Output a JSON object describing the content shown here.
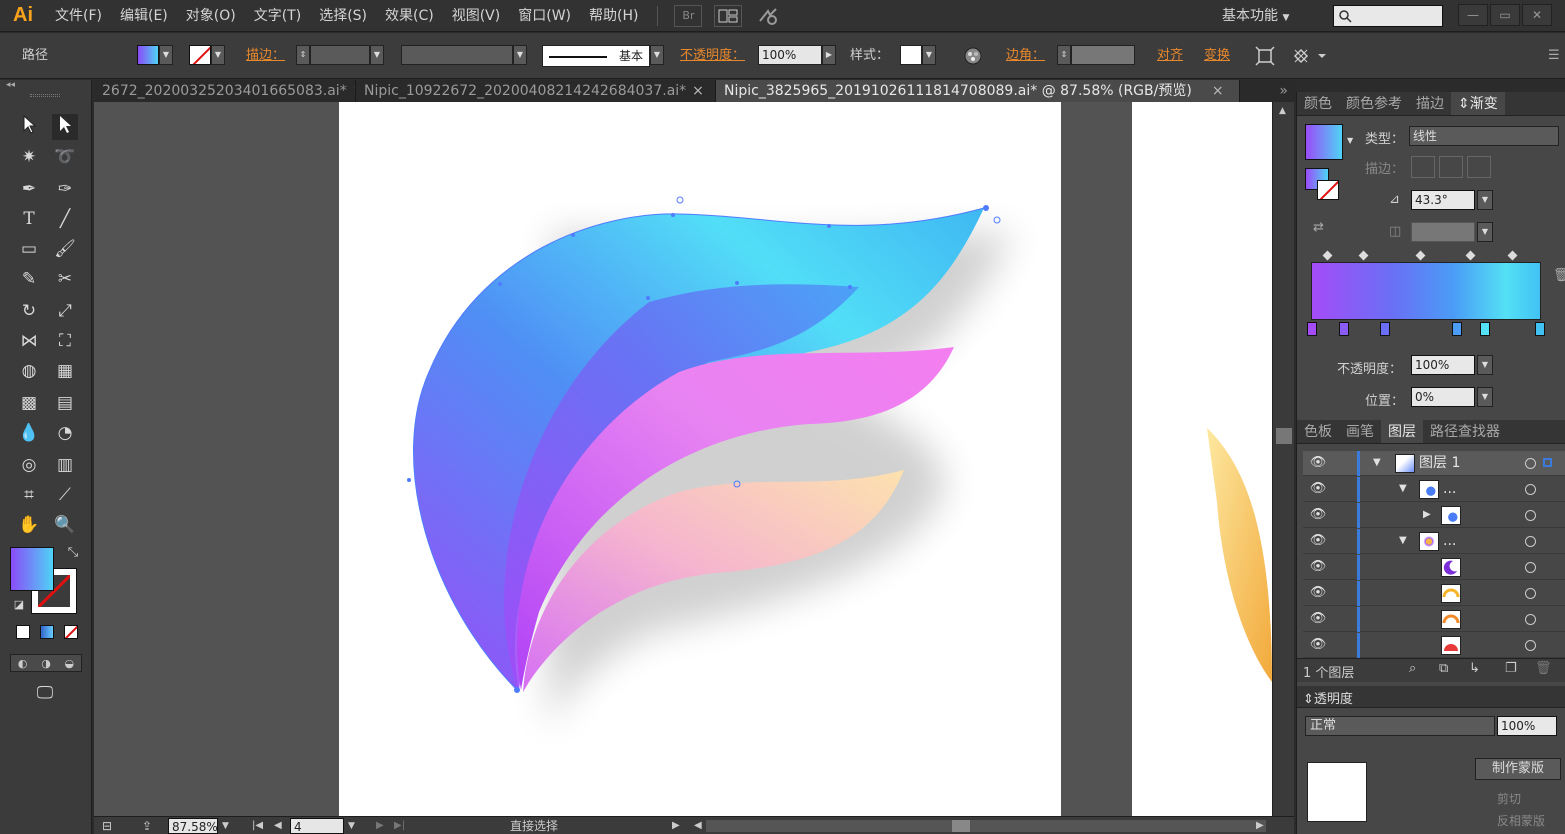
{
  "menubar": {
    "logo": "Ai",
    "items": [
      "文件(F)",
      "编辑(E)",
      "对象(O)",
      "文字(T)",
      "选择(S)",
      "效果(C)",
      "视图(V)",
      "窗口(W)",
      "帮助(H)"
    ],
    "bridge_label": "Br",
    "workspace": "基本功能",
    "search_placeholder": "",
    "win_min": "—",
    "win_restore": "▭",
    "win_close": "✕"
  },
  "controlbar": {
    "selection_type": "路径",
    "stroke_label": "描边：",
    "stroke_style": "基本",
    "opacity_label": "不透明度：",
    "opacity_value": "100%",
    "style_label": "样式：",
    "corner_label": "边角：",
    "align_label": "对齐",
    "transform_label": "变换"
  },
  "tabs": [
    {
      "label": "2672_20200325203401665083.ai*",
      "active": false
    },
    {
      "label": "Nipic_10922672_20200408214242684037.ai*",
      "active": false
    },
    {
      "label": "Nipic_3825965_20191026111814708089.ai* @ 87.58% (RGB/预览)",
      "active": true
    }
  ],
  "tab_close": "×",
  "tab_overflow": "»",
  "statusbar": {
    "zoom": "87.58%",
    "artboard": "4",
    "tool_name": "直接选择"
  },
  "gradient_panel": {
    "tabs": [
      "颜色",
      "颜色参考",
      "描边",
      "渐变"
    ],
    "active_tab": "渐变",
    "type_label": "类型：",
    "type_value": "线性",
    "stroke_label": "描边：",
    "angle_value": "43.3°",
    "opacity_label": "不透明度：",
    "opacity_value": "100%",
    "position_label": "位置：",
    "position_value": "0%",
    "colors": [
      "#a44cf8",
      "#6a6ff5",
      "#4a9cf6",
      "#54e0f5",
      "#41c2f3"
    ]
  },
  "layers_panel": {
    "tabs": [
      "色板",
      "画笔",
      "图层",
      "路径查找器"
    ],
    "active_tab": "图层",
    "rows": [
      {
        "name": "图层 1",
        "indent": 0,
        "expanded": true
      },
      {
        "name": "...",
        "indent": 1,
        "expanded": true
      },
      {
        "name": "",
        "indent": 2,
        "expanded": false
      },
      {
        "name": "...",
        "indent": 1,
        "expanded": true
      },
      {
        "name": "",
        "indent": 2,
        "expanded": null
      },
      {
        "name": "",
        "indent": 2,
        "expanded": null
      },
      {
        "name": "",
        "indent": 2,
        "expanded": null
      },
      {
        "name": "",
        "indent": 2,
        "expanded": null
      }
    ],
    "footer_count": "1 个图层"
  },
  "transparency_panel": {
    "title": "透明度",
    "blend_mode": "正常",
    "opacity_value": "100%",
    "make_mask": "制作蒙版",
    "clip_label": "剪切",
    "invert_label": "反相蒙版"
  },
  "accent_color": "#e8882c"
}
